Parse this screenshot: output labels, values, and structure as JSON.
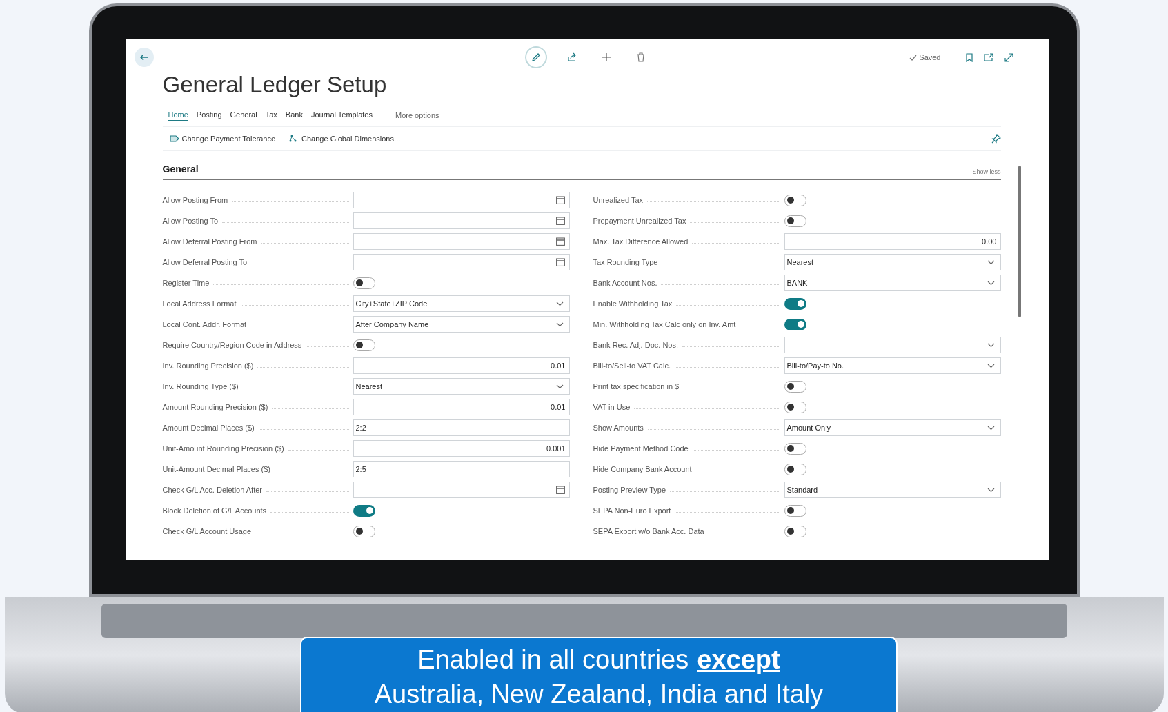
{
  "toolbar": {
    "status": "Saved"
  },
  "title": "General Ledger Setup",
  "tabs": [
    {
      "label": "Home",
      "selected": true
    },
    {
      "label": "Posting",
      "selected": false
    },
    {
      "label": "General",
      "selected": false
    },
    {
      "label": "Tax",
      "selected": false
    },
    {
      "label": "Bank",
      "selected": false
    },
    {
      "label": "Journal Templates",
      "selected": false
    }
  ],
  "more_options": "More options",
  "actions": [
    "Change Payment Tolerance",
    "Change Global Dimensions..."
  ],
  "section": {
    "title": "General",
    "toggle": "Show less"
  },
  "left_fields": [
    {
      "kind": "date",
      "label": "Allow Posting From"
    },
    {
      "kind": "date",
      "label": "Allow Posting To"
    },
    {
      "kind": "date",
      "label": "Allow Deferral Posting From"
    },
    {
      "kind": "date",
      "label": "Allow Deferral Posting To"
    },
    {
      "kind": "toggle",
      "label": "Register Time",
      "on": false
    },
    {
      "kind": "select",
      "label": "Local Address Format",
      "value": "City+State+ZIP Code"
    },
    {
      "kind": "select",
      "label": "Local Cont. Addr. Format",
      "value": "After Company Name"
    },
    {
      "kind": "toggle",
      "label": "Require Country/Region Code in Address",
      "on": false
    },
    {
      "kind": "number",
      "label": "Inv. Rounding Precision ($)",
      "value": "0.01"
    },
    {
      "kind": "select",
      "label": "Inv. Rounding Type ($)",
      "value": "Nearest"
    },
    {
      "kind": "number",
      "label": "Amount Rounding Precision ($)",
      "value": "0.01"
    },
    {
      "kind": "text",
      "label": "Amount Decimal Places ($)",
      "value": "2:2"
    },
    {
      "kind": "number",
      "label": "Unit-Amount Rounding Precision ($)",
      "value": "0.001"
    },
    {
      "kind": "text",
      "label": "Unit-Amount Decimal Places ($)",
      "value": "2:5"
    },
    {
      "kind": "date",
      "label": "Check G/L Acc. Deletion After"
    },
    {
      "kind": "toggle",
      "label": "Block Deletion of G/L Accounts",
      "on": true
    },
    {
      "kind": "toggle",
      "label": "Check G/L Account Usage",
      "on": false
    }
  ],
  "right_fields": [
    {
      "kind": "toggle",
      "label": "Unrealized Tax",
      "on": false
    },
    {
      "kind": "toggle",
      "label": "Prepayment Unrealized Tax",
      "on": false
    },
    {
      "kind": "number",
      "label": "Max. Tax Difference Allowed",
      "value": "0.00"
    },
    {
      "kind": "select",
      "label": "Tax Rounding Type",
      "value": "Nearest"
    },
    {
      "kind": "select",
      "label": "Bank Account Nos.",
      "value": "BANK"
    },
    {
      "kind": "toggle",
      "label": "Enable Withholding Tax",
      "on": true
    },
    {
      "kind": "toggle",
      "label": "Min. Withholding Tax Calc only on Inv. Amt",
      "on": true
    },
    {
      "kind": "select",
      "label": "Bank Rec. Adj. Doc. Nos."
    },
    {
      "kind": "select",
      "label": "Bill-to/Sell-to VAT Calc.",
      "value": "Bill-to/Pay-to No."
    },
    {
      "kind": "toggle",
      "label": "Print tax specification in $",
      "on": false
    },
    {
      "kind": "toggle",
      "label": "VAT in Use",
      "on": false
    },
    {
      "kind": "select",
      "label": "Show Amounts",
      "value": "Amount Only"
    },
    {
      "kind": "toggle",
      "label": "Hide Payment Method Code",
      "on": false
    },
    {
      "kind": "toggle",
      "label": "Hide Company Bank Account",
      "on": false
    },
    {
      "kind": "select",
      "label": "Posting Preview Type",
      "value": "Standard"
    },
    {
      "kind": "toggle",
      "label": "SEPA Non-Euro Export",
      "on": false
    },
    {
      "kind": "toggle",
      "label": "SEPA Export w/o Bank Acc. Data",
      "on": false
    }
  ],
  "banner": {
    "text": "Enabled in all countries",
    "emphasis": "except",
    "line2": "Australia, New Zealand, India and Italy"
  }
}
